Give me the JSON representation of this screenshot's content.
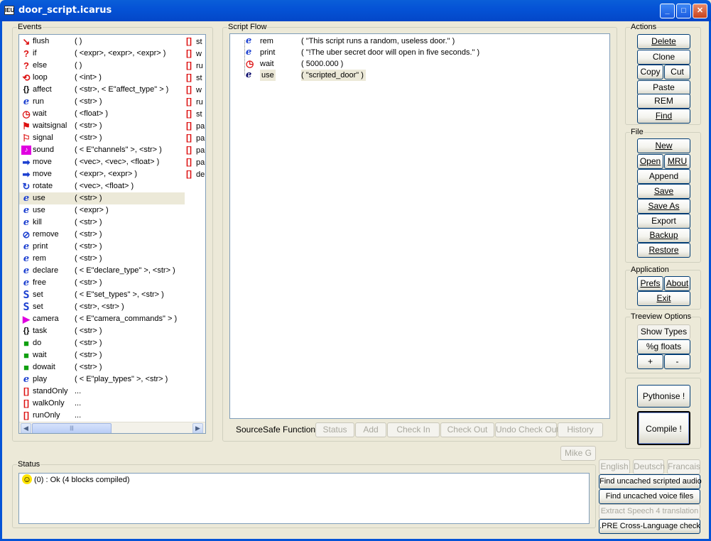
{
  "window": {
    "title": "door_script.icarus",
    "app_icon_text": "IEU",
    "minimize": "_",
    "maximize": "□",
    "close": "✕"
  },
  "events": {
    "label": "Events",
    "items": [
      {
        "icon": "↘",
        "name": "flush",
        "args": "(  )",
        "tail": "st"
      },
      {
        "icon": "?",
        "name": "if",
        "args": "( <expr>, <expr>, <expr> )",
        "tail": "w"
      },
      {
        "icon": "?",
        "name": "else",
        "args": "(  )",
        "tail": "ru"
      },
      {
        "icon": "⟲",
        "name": "loop",
        "args": "( <int> )",
        "tail": "st"
      },
      {
        "icon": "{}",
        "name": "affect",
        "args": "( <str>, < E\"affect_type\" > )",
        "tail": "w"
      },
      {
        "icon": "e",
        "name": "run",
        "args": "( <str> )",
        "tail": "ru"
      },
      {
        "icon": "◷",
        "name": "wait",
        "args": "( <float> )",
        "tail": "st"
      },
      {
        "icon": "⚑",
        "name": "waitsignal",
        "args": "( <str> )",
        "tail": "pa"
      },
      {
        "icon": "⚐",
        "name": "signal",
        "args": "( <str> )",
        "tail": "pa"
      },
      {
        "icon": "♪",
        "name": "sound",
        "args": "( < E\"channels\" >, <str> )",
        "tail": "pa"
      },
      {
        "icon": "➡",
        "name": "move",
        "args": "( <vec>, <vec>, <float> )",
        "tail": "pa"
      },
      {
        "icon": "➡",
        "name": "move",
        "args": "( <expr>, <expr> )",
        "tail": "de"
      },
      {
        "icon": "↻",
        "name": "rotate",
        "args": "( <vec>, <float> )",
        "tail": ""
      },
      {
        "icon": "e",
        "name": "use",
        "args": "( <str> )",
        "tail": ""
      },
      {
        "icon": "e",
        "name": "use",
        "args": "( <expr> )",
        "tail": ""
      },
      {
        "icon": "e",
        "name": "kill",
        "args": "( <str> )",
        "tail": ""
      },
      {
        "icon": "⊘",
        "name": "remove",
        "args": "( <str> )",
        "tail": ""
      },
      {
        "icon": "e",
        "name": "print",
        "args": "( <str> )",
        "tail": ""
      },
      {
        "icon": "e",
        "name": "rem",
        "args": "( <str> )",
        "tail": ""
      },
      {
        "icon": "e",
        "name": "declare",
        "args": "( < E\"declare_type\" >, <str> )",
        "tail": ""
      },
      {
        "icon": "e",
        "name": "free",
        "args": "( <str> )",
        "tail": ""
      },
      {
        "icon": "S",
        "name": "set",
        "args": "( < E\"set_types\" >, <str> )",
        "tail": ""
      },
      {
        "icon": "S",
        "name": "set",
        "args": "( <str>, <str> )",
        "tail": ""
      },
      {
        "icon": "▶",
        "name": "camera",
        "args": "( < E\"camera_commands\" > )",
        "tail": ""
      },
      {
        "icon": "{}",
        "name": "task",
        "args": "( <str> )",
        "tail": ""
      },
      {
        "icon": "■",
        "name": "do",
        "args": "( <str> )",
        "tail": ""
      },
      {
        "icon": "■",
        "name": "wait",
        "args": "( <str> )",
        "tail": ""
      },
      {
        "icon": "■",
        "name": "dowait",
        "args": "( <str> )",
        "tail": ""
      },
      {
        "icon": "e",
        "name": "play",
        "args": "( < E\"play_types\" >, <str> )",
        "tail": ""
      },
      {
        "icon": "[]",
        "name": "standOnly",
        "args": "...",
        "tail": ""
      },
      {
        "icon": "[]",
        "name": "walkOnly",
        "args": "...",
        "tail": ""
      },
      {
        "icon": "[]",
        "name": "runOnly",
        "args": "...",
        "tail": ""
      }
    ],
    "scroll_left": "◀",
    "scroll_right": "▶",
    "thumb_grip": "|||"
  },
  "flow": {
    "label": "Script Flow",
    "items": [
      {
        "icon": "e",
        "name": "rem",
        "args": "( \"This script runs a random, useless door.\" )"
      },
      {
        "icon": "e",
        "name": "print",
        "args": "( \"!The uber secret door will open in five seconds.\" )"
      },
      {
        "icon": "◷",
        "name": "wait",
        "args": "( 5000.000 )"
      },
      {
        "icon": "e",
        "name": "use",
        "args": "( \"scripted_door\" )"
      }
    ],
    "sourcesafe_label": "SourceSafe Functions:",
    "sourcesafe": [
      "Status",
      "Add",
      "Check In",
      "Check Out",
      "Undo Check Out",
      "History"
    ]
  },
  "actions": {
    "label": "Actions",
    "delete": "Delete",
    "clone": "Clone",
    "copy": "Copy",
    "cut": "Cut",
    "paste": "Paste",
    "rem": "REM",
    "find": "Find"
  },
  "file": {
    "label": "File",
    "new": "New",
    "open": "Open",
    "mru": "MRU",
    "append": "Append",
    "save": "Save",
    "save_as": "Save As",
    "export": "Export",
    "backup": "Backup",
    "restore": "Restore"
  },
  "application": {
    "label": "Application",
    "prefs": "Prefs",
    "about": "About",
    "exit": "Exit"
  },
  "treeview": {
    "label": "Treeview Options",
    "show_types": "Show Types",
    "g_floats": "%g floats",
    "plus": "+",
    "minus": "-"
  },
  "bottom_right": {
    "pythonise": "Pythonise !",
    "compile": "Compile !"
  },
  "user_button": "Mike G",
  "status": {
    "label": "Status",
    "icon": "☺",
    "message": "(0) : Ok   (4 blocks compiled)"
  },
  "lang": {
    "english": "English",
    "deutsch": "Deutsch",
    "francais": "Francais"
  },
  "tools": {
    "find_audio": "Find uncached scripted audio",
    "find_voice": "Find uncached voice files",
    "extract_speech": "Extract Speech 4 translation",
    "pre_check": ".PRE Cross-Language check"
  }
}
